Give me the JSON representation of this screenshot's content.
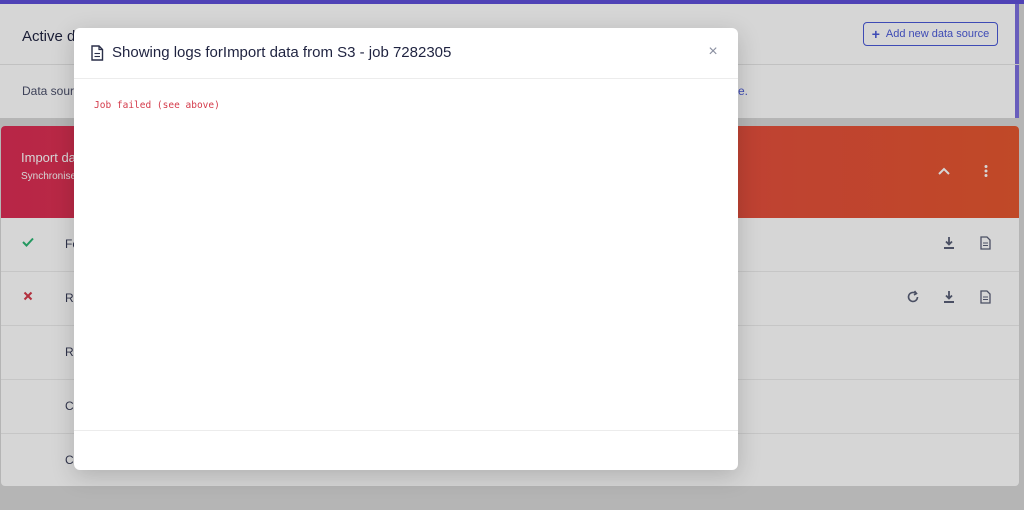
{
  "background_card": {
    "title": "Active d",
    "add_button_label": "Add new data source",
    "description_start": "Data sour",
    "description_end": "re."
  },
  "job_card": {
    "title": "Import da",
    "subtitle": "Synchronise",
    "rows": [
      {
        "status": "success",
        "label": "Fe"
      },
      {
        "status": "failed",
        "label": "Re"
      },
      {
        "status": "none",
        "label": "Re"
      },
      {
        "status": "none",
        "label": "Cr"
      },
      {
        "status": "none",
        "label": "Cr"
      }
    ]
  },
  "modal": {
    "title": "Showing logs forImport data from S3 - job 7282305",
    "close_label": "×",
    "log_text": "Job failed (see above)"
  },
  "icons": {
    "header_icon": "document-icon",
    "close_icon": "close-icon",
    "success_icon": "check-icon",
    "failed_icon": "cross-icon",
    "collapse_icon": "chevron-up-icon",
    "menu_icon": "kebab-menu-icon",
    "download_icon": "download-icon",
    "log_icon": "document-icon",
    "retry_icon": "retry-icon"
  },
  "colors": {
    "accent": "#4a5ad8",
    "header_gradient_start": "#dc2d55",
    "header_gradient_end": "#e5572f",
    "success": "#2bb673",
    "error": "#d43a4a"
  }
}
